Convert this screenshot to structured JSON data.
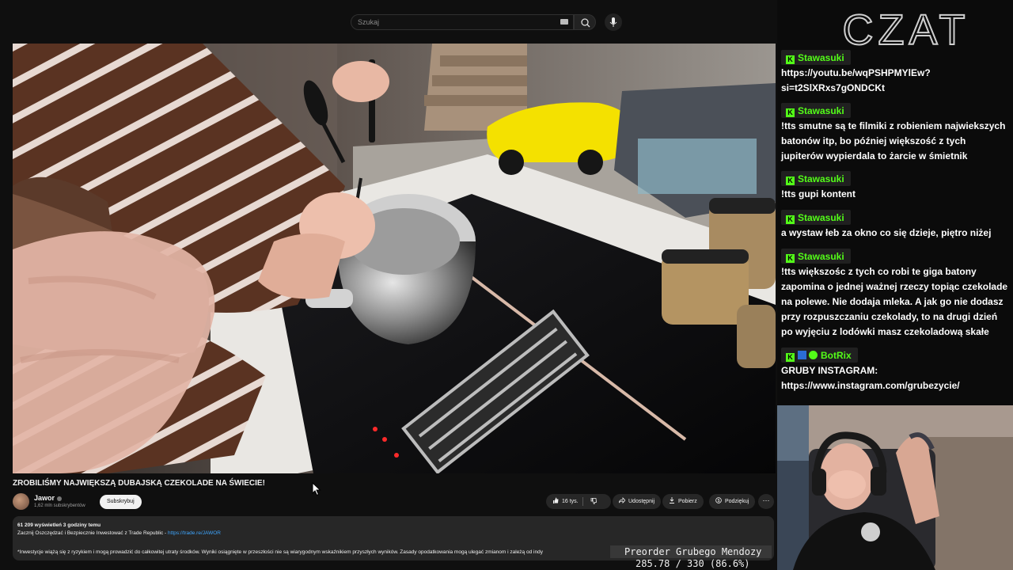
{
  "search": {
    "placeholder": "Szukaj"
  },
  "video": {
    "title": "ZROBILIŚMY NAJWIĘKSZĄ DUBAJSKĄ CZEKOLADE NA ŚWIECIE!",
    "channel_name": "Jawor",
    "subscribers": "1,62 mln subskrybentów",
    "subscribe_label": "Subskrybuj",
    "likes": "16 tys.",
    "share_label": "Udostępnij",
    "download_label": "Pobierz",
    "thanks_label": "Podziękuj",
    "more_label": "⋯"
  },
  "description": {
    "meta": "61 209 wyświetleń  3 godziny temu",
    "line1": "Zacznij Oszczędzać i Bezpiecznie Inwestować z Trade Republic - ",
    "link": "https://trade.re/JAWOR",
    "disclaimer": "*Inwestycje wiążą się z ryzykiem i mogą prowadzić do całkowitej utraty środków. Wyniki osiągnięte w przeszłości nie są wiarygodnym wskaźnikiem przyszłych wyników. Zasady opodatkowania mogą ulegać zmianom i zależą od indy"
  },
  "chat": {
    "logo": "CZAT",
    "messages": [
      {
        "user": "Stawasuki",
        "text": "https://youtu.be/wqPSHPMYlEw?si=t2SlXRxs7gONDCKt"
      },
      {
        "user": "Stawasuki",
        "text": "!tts smutne są te filmiki z robieniem najwiekszych batonów itp, bo później większość z tych jupiterów wypierdala to żarcie w śmietnik"
      },
      {
        "user": "Stawasuki",
        "text": "!tts gupi kontent"
      },
      {
        "user": "Stawasuki",
        "text": "a wystaw łeb za okno co się dzieje, piętro niżej"
      },
      {
        "user": "Stawasuki",
        "text": "!tts większośc z tych co robi te giga batony zapomina o jednej ważnej rzeczy topiąc czekolade na polewe. Nie dodaja mleka. A jak go nie dodasz przy rozpuszczaniu czekolady, to na drugi dzień po wyjęciu z lodówki masz czekoladową skałe"
      },
      {
        "user": "BotRix",
        "text": "GRUBY INSTAGRAM: https://www.instagram.com/grubezycie/"
      }
    ]
  },
  "overlay": {
    "preorder": "Preorder Grubego Mendozy",
    "progress": "285.78 / 330 (86.6%)"
  },
  "colors": {
    "kick_green": "#53fc18",
    "link_blue": "#3ea6ff"
  }
}
